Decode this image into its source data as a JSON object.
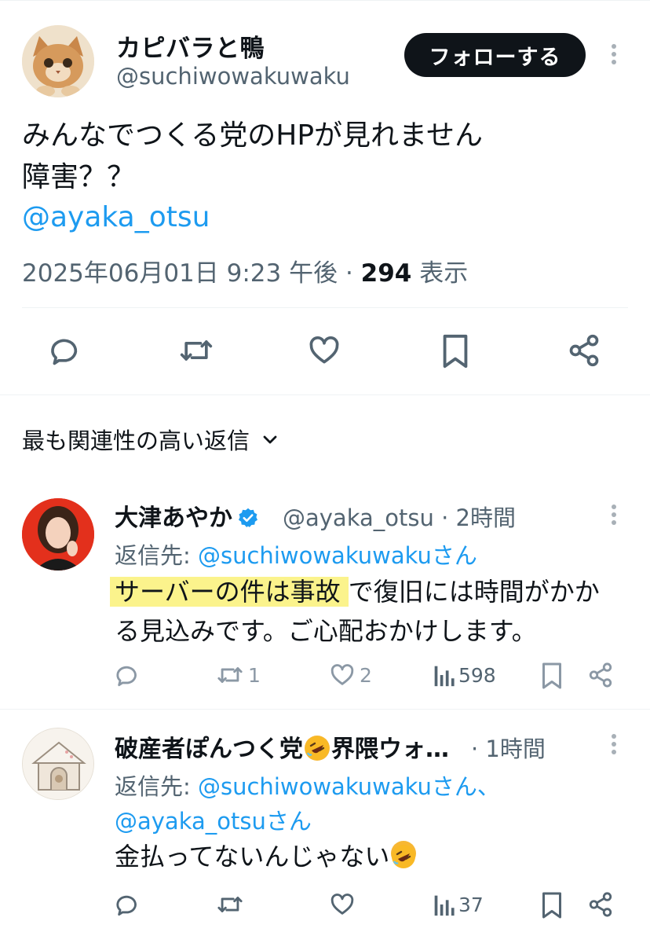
{
  "main_tweet": {
    "author_name": "カピバラと鴨",
    "author_handle": "@suchiwowakuwaku",
    "follow_label": "フォローする",
    "text_line1": "みんなでつくる党のHPが見れません",
    "text_line2": "障害？？",
    "mention": "@ayaka_otsu",
    "timestamp": "2025年06月01日 9:23 午後 · ",
    "views_count": "294",
    "views_label": " 表示"
  },
  "replies_header": {
    "label": "最も関連性の高い返信"
  },
  "replies": [
    {
      "author_name": "大津あやか",
      "verified": true,
      "handle_time": "@ayaka_otsu · 2時間",
      "reply_to_prefix": "返信先: ",
      "reply_to_link": "@suchiwowakuwakuさん",
      "text_highlight": "サーバーの件は事故",
      "text_rest": "で復旧には時間がかか",
      "text_line2": "る見込みです。ご心配おかけします。",
      "reposts": "1",
      "likes": "2",
      "views": "598"
    },
    {
      "author_name": "破産者ぽんつく党",
      "author_name_tail": "界隈ウォ…",
      "handle_time": " · 1時間",
      "reply_to_prefix": "返信先: ",
      "reply_to_link1": "@suchiwowakuwakuさん、",
      "reply_to_link2": "@ayaka_otsuさん",
      "text": "金払ってないんじゃない",
      "views": "37"
    }
  ],
  "colors": {
    "link": "#1d9bf0",
    "secondary": "#536471",
    "highlight": "#fbf38c",
    "verified": "#1d9bf0"
  }
}
